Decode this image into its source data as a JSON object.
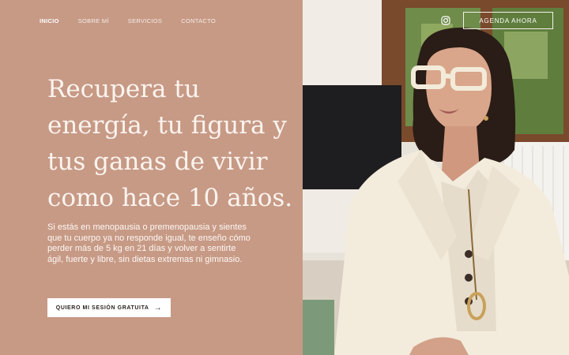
{
  "nav": {
    "items": [
      {
        "label": "INICIO",
        "active": true
      },
      {
        "label": "SOBRE MÍ",
        "active": false
      },
      {
        "label": "SERVICIOS",
        "active": false
      },
      {
        "label": "CONTACTO",
        "active": false
      }
    ],
    "book_label": "AGENDA AHORA",
    "instagram_icon": "instagram-icon"
  },
  "hero": {
    "headline_lines": [
      "Recupera tu",
      "energía, tu figura y",
      "tus ganas de vivir",
      "como hace 10 años."
    ],
    "description": "Si estás en menopausia o premenopausia y sientes que tu cuerpo ya no responde igual, te enseño cómo perder más de 5 kg en 21 días y volver a sentirte ágil, fuerte y libre, sin dietas extremas ni gimnasio.",
    "cta_label": "QUIERO MI SESIÓN GRATUITA",
    "cta_arrow": "→"
  },
  "colors": {
    "panel": "#c79a86",
    "text_light": "#fbf4ef",
    "button_bg": "#ffffff"
  }
}
